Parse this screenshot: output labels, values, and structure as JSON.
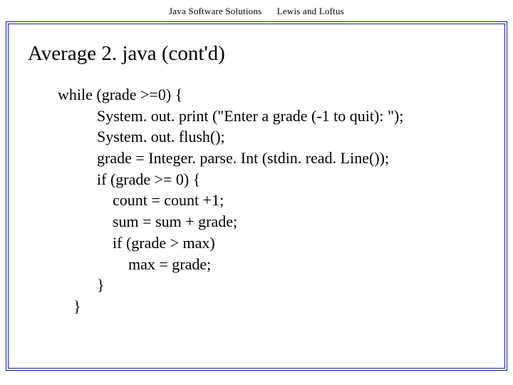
{
  "header": {
    "left": "Java Software Solutions",
    "right": "Lewis and Loftus"
  },
  "title": "Average 2. java (cont'd)",
  "code": "while (grade >=0) {\n          System. out. print (\"Enter a grade (-1 to quit): \");\n          System. out. flush();\n          grade = Integer. parse. Int (stdin. read. Line());\n          if (grade >= 0) {\n              count = count +1;\n              sum = sum + grade;\n              if (grade > max)\n                  max = grade;\n          }\n    }"
}
